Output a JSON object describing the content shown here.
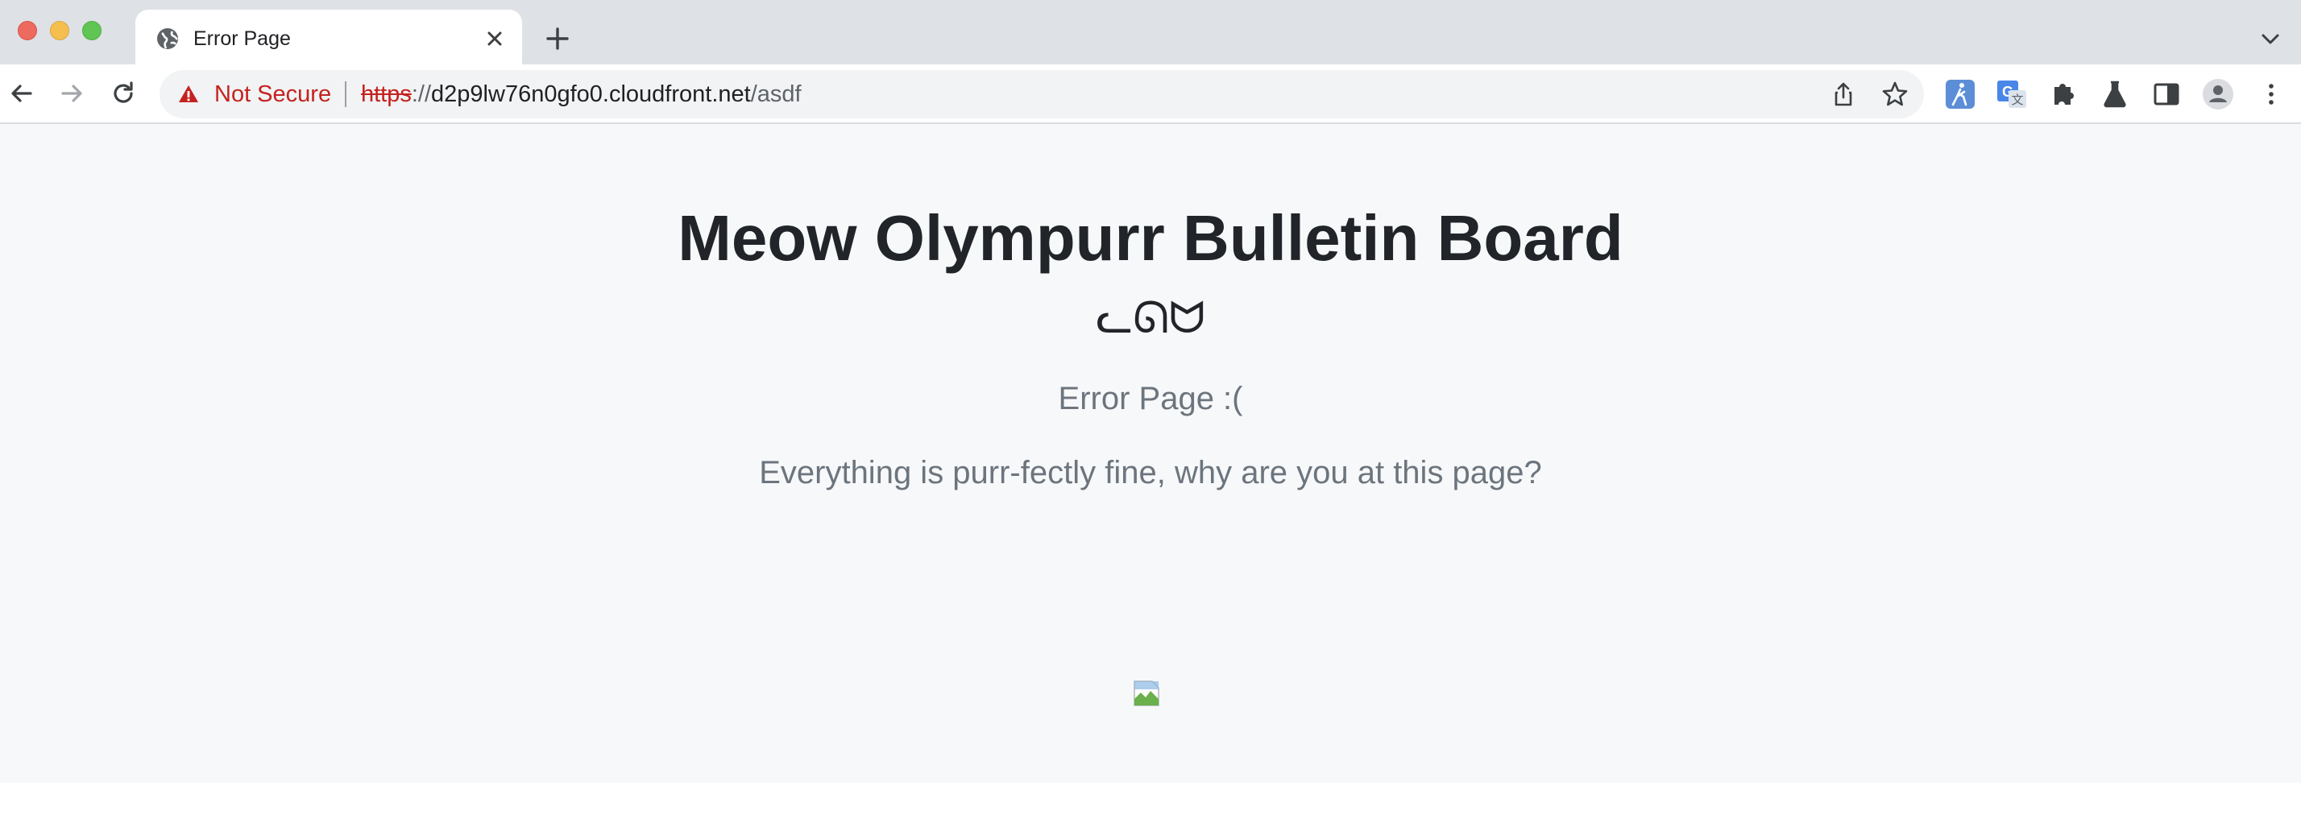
{
  "browser": {
    "tab": {
      "title": "Error Page"
    },
    "address": {
      "security_label": "Not Secure",
      "scheme": "https",
      "scheme_sep": "://",
      "host": "d2p9lw76n0gfo0.cloudfront.net",
      "path": "/asdf"
    }
  },
  "page": {
    "title": "Meow Olympurr Bulletin Board",
    "cat_face": "ᓚᘏᗢ",
    "subtitle": "Error Page :(",
    "message": "Everything is purr-fectly fine, why are you at this page?"
  }
}
